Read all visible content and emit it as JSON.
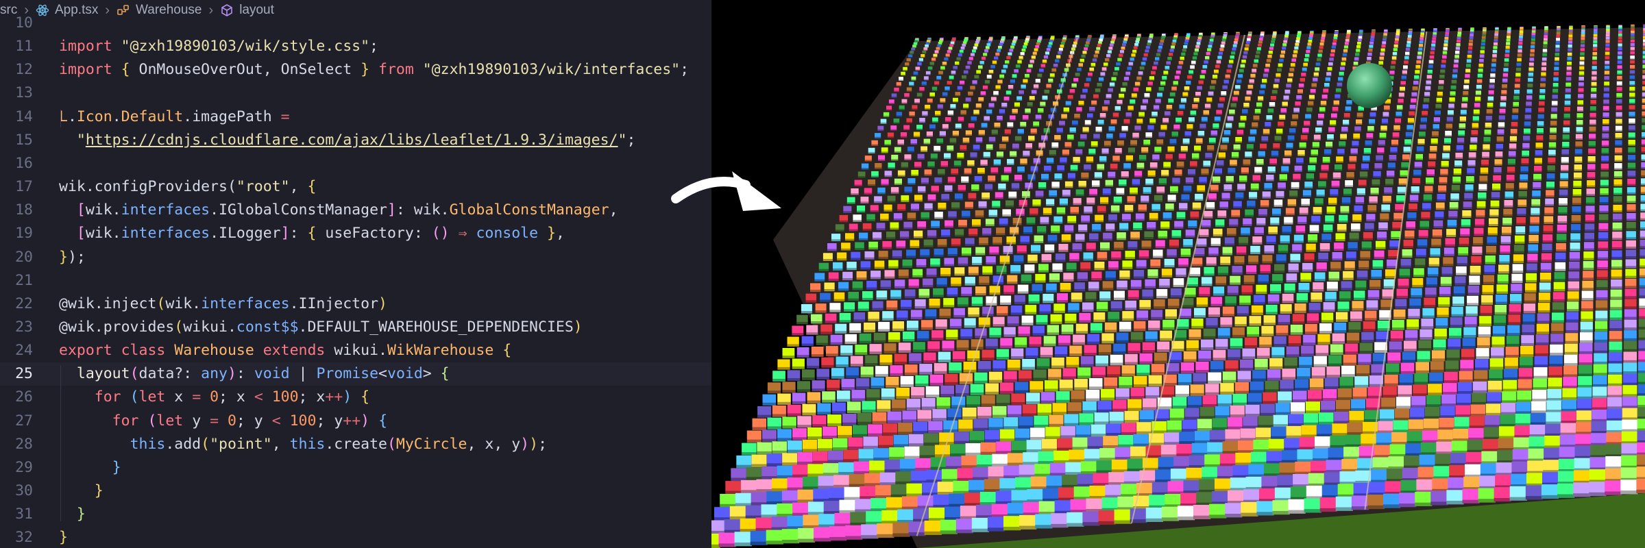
{
  "breadcrumb": {
    "items": [
      "src",
      "App.tsx",
      "Warehouse",
      "layout"
    ]
  },
  "editor": {
    "active_line": "25",
    "lines": [
      {
        "n": "10",
        "t": []
      },
      {
        "n": "11",
        "t": [
          [
            "k",
            "import "
          ],
          [
            "s",
            "\"@zxh19890103/wik/style.css\""
          ],
          [
            "d",
            ";"
          ]
        ]
      },
      {
        "n": "12",
        "t": [
          [
            "k",
            "import "
          ],
          [
            "y",
            "{ "
          ],
          [
            "d",
            "OnMouseOverOut, OnSelect "
          ],
          [
            "y",
            "} "
          ],
          [
            "k",
            "from "
          ],
          [
            "s",
            "\"@zxh19890103/wik/interfaces\""
          ],
          [
            "d",
            ";"
          ]
        ]
      },
      {
        "n": "13",
        "t": []
      },
      {
        "n": "14",
        "t": [
          [
            "t",
            "L"
          ],
          [
            "d",
            "."
          ],
          [
            "t",
            "Icon"
          ],
          [
            "d",
            "."
          ],
          [
            "t",
            "Default"
          ],
          [
            "d",
            ".imagePath "
          ],
          [
            "o",
            "="
          ]
        ]
      },
      {
        "n": "15",
        "t": [
          [
            "d",
            "  "
          ],
          [
            "s",
            "\""
          ],
          [
            "u",
            "https://cdnjs.cloudflare.com/ajax/libs/leaflet/1.9.3/images/"
          ],
          [
            "s",
            "\""
          ],
          [
            "d",
            ";"
          ]
        ]
      },
      {
        "n": "16",
        "t": []
      },
      {
        "n": "17",
        "t": [
          [
            "d",
            "wik.configProviders("
          ],
          [
            "s",
            "\"root\""
          ],
          [
            "d",
            ", "
          ],
          [
            "y",
            "{"
          ]
        ]
      },
      {
        "n": "18",
        "t": [
          [
            "d",
            "  "
          ],
          [
            "p",
            "["
          ],
          [
            "d",
            "wik."
          ],
          [
            "c",
            "interfaces"
          ],
          [
            "d",
            ".IGlobalConstManager"
          ],
          [
            "p",
            "]"
          ],
          [
            "d",
            ": wik."
          ],
          [
            "t",
            "GlobalConstManager"
          ],
          [
            "d",
            ","
          ]
        ]
      },
      {
        "n": "19",
        "t": [
          [
            "d",
            "  "
          ],
          [
            "p",
            "["
          ],
          [
            "d",
            "wik."
          ],
          [
            "c",
            "interfaces"
          ],
          [
            "d",
            ".ILogger"
          ],
          [
            "p",
            "]"
          ],
          [
            "d",
            ": "
          ],
          [
            "y",
            "{ "
          ],
          [
            "d",
            "useFactory: "
          ],
          [
            "p",
            "() "
          ],
          [
            "o",
            "⇒ "
          ],
          [
            "c",
            "console "
          ],
          [
            "y",
            "}"
          ],
          [
            "d",
            ","
          ]
        ]
      },
      {
        "n": "20",
        "t": [
          [
            "y",
            "}"
          ],
          [
            "d",
            ");"
          ]
        ]
      },
      {
        "n": "21",
        "t": []
      },
      {
        "n": "22",
        "t": [
          [
            "d",
            "@wik.inject"
          ],
          [
            "y",
            "("
          ],
          [
            "d",
            "wik."
          ],
          [
            "c",
            "interfaces"
          ],
          [
            "d",
            ".IInjector"
          ],
          [
            "y",
            ")"
          ]
        ]
      },
      {
        "n": "23",
        "t": [
          [
            "d",
            "@wik.provides"
          ],
          [
            "y",
            "("
          ],
          [
            "d",
            "wikui."
          ],
          [
            "c",
            "const$$"
          ],
          [
            "d",
            ".DEFAULT_WAREHOUSE_DEPENDENCIES"
          ],
          [
            "y",
            ")"
          ]
        ]
      },
      {
        "n": "24",
        "t": [
          [
            "k",
            "export class "
          ],
          [
            "t",
            "Warehouse "
          ],
          [
            "k",
            "extends "
          ],
          [
            "d",
            "wikui."
          ],
          [
            "t",
            "WikWarehouse "
          ],
          [
            "y",
            "{"
          ]
        ]
      },
      {
        "n": "25",
        "t": [
          [
            "d",
            "  "
          ],
          [
            "f",
            "layout"
          ],
          [
            "p",
            "("
          ],
          [
            "d",
            "data?: "
          ],
          [
            "c",
            "any"
          ],
          [
            "p",
            ")"
          ],
          [
            "d",
            ": "
          ],
          [
            "c",
            "void "
          ],
          [
            "d",
            "| "
          ],
          [
            "c",
            "Promise"
          ],
          [
            "d",
            "<"
          ],
          [
            "c",
            "void"
          ],
          [
            "d",
            "> "
          ],
          [
            "b",
            "{"
          ]
        ]
      },
      {
        "n": "26",
        "t": [
          [
            "d",
            "    "
          ],
          [
            "k",
            "for "
          ],
          [
            "l",
            "("
          ],
          [
            "k",
            "let "
          ],
          [
            "d",
            "x "
          ],
          [
            "o",
            "= "
          ],
          [
            "n",
            "0"
          ],
          [
            "d",
            "; x "
          ],
          [
            "o",
            "< "
          ],
          [
            "n",
            "100"
          ],
          [
            "d",
            "; x"
          ],
          [
            "o",
            "++"
          ],
          [
            "l",
            ") "
          ],
          [
            "y",
            "{"
          ]
        ]
      },
      {
        "n": "27",
        "t": [
          [
            "d",
            "      "
          ],
          [
            "k",
            "for "
          ],
          [
            "p",
            "("
          ],
          [
            "k",
            "let "
          ],
          [
            "d",
            "y "
          ],
          [
            "o",
            "= "
          ],
          [
            "n",
            "0"
          ],
          [
            "d",
            "; y "
          ],
          [
            "o",
            "< "
          ],
          [
            "n",
            "100"
          ],
          [
            "d",
            "; y"
          ],
          [
            "o",
            "++"
          ],
          [
            "p",
            ") "
          ],
          [
            "l",
            "{"
          ]
        ]
      },
      {
        "n": "28",
        "t": [
          [
            "d",
            "        "
          ],
          [
            "c",
            "this"
          ],
          [
            "d",
            ".add"
          ],
          [
            "y",
            "("
          ],
          [
            "s",
            "\"point\""
          ],
          [
            "d",
            ", "
          ],
          [
            "c",
            "this"
          ],
          [
            "d",
            ".create"
          ],
          [
            "p",
            "("
          ],
          [
            "t",
            "MyCircle"
          ],
          [
            "d",
            ", x, y"
          ],
          [
            "p",
            ")"
          ],
          [
            "y",
            ")"
          ],
          [
            "d",
            ";"
          ]
        ]
      },
      {
        "n": "29",
        "t": [
          [
            "d",
            "      "
          ],
          [
            "l",
            "}"
          ]
        ]
      },
      {
        "n": "30",
        "t": [
          [
            "d",
            "    "
          ],
          [
            "y",
            "}"
          ]
        ]
      },
      {
        "n": "31",
        "t": [
          [
            "d",
            "  "
          ],
          [
            "b",
            "}"
          ]
        ]
      },
      {
        "n": "32",
        "t": [
          [
            "y",
            "}"
          ]
        ]
      }
    ]
  },
  "scene": {
    "rows": 100,
    "cols": 100,
    "ground_color": "#3c6a1a",
    "sky_color": "#000000",
    "sphere_color": "#3f9e6a",
    "rail_color": "#d8c6a2"
  }
}
